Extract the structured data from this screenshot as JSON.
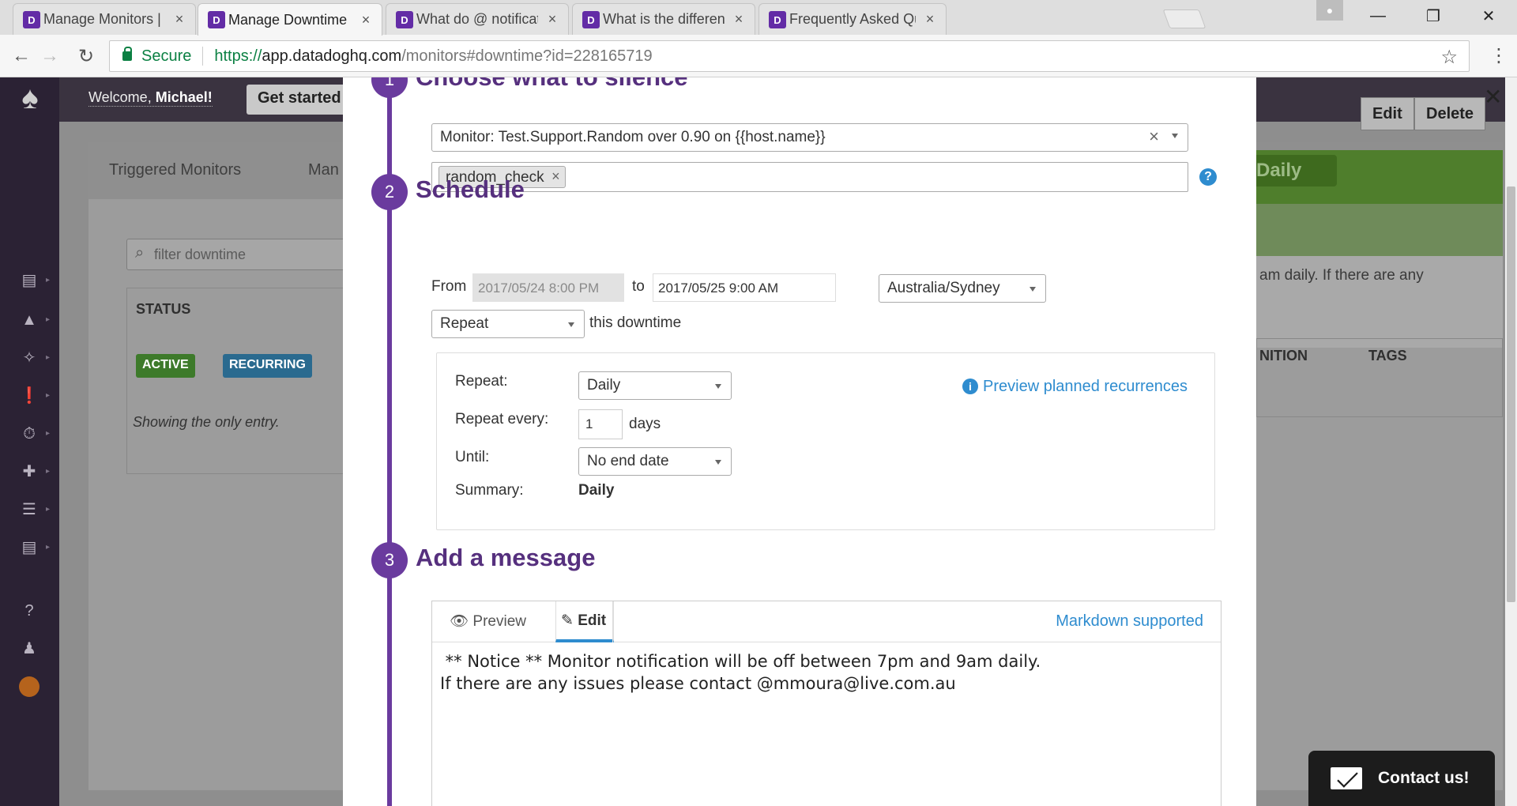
{
  "browser": {
    "tabs": [
      {
        "title": "Manage Monitors | Datad",
        "active": false
      },
      {
        "title": "Manage Downtime | Datad",
        "active": true
      },
      {
        "title": "What do @ notifications",
        "active": false
      },
      {
        "title": "What is the difference be",
        "active": false
      },
      {
        "title": "Frequently Asked Questio",
        "active": false
      }
    ],
    "secure_label": "Secure",
    "url_scheme": "https://",
    "url_host": "app.datadoghq.com",
    "url_path": "/monitors#downtime?id=228165719"
  },
  "app": {
    "welcome_prefix": "Welcome, ",
    "welcome_name": "Michael!",
    "get_started": "Get started",
    "bg_tab_triggered": "Triggered Monitors",
    "bg_tab_manage": "Man",
    "filter_placeholder": "filter downtime",
    "status_header": "STATUS",
    "badge_active": "ACTIVE",
    "badge_recurring": "RECURRING",
    "showing_entry": "Showing the only entry.",
    "edit": "Edit",
    "delete": "Delete",
    "daily_badge": "Daily",
    "bg_message": "am daily. If there are any",
    "bg_col_definition": "NITION",
    "bg_col_tags": "TAGS"
  },
  "modal": {
    "step1": {
      "number": "1",
      "title": "Choose what to silence"
    },
    "monitor_select": "Monitor: Test.Support.Random over 0.90 on {{host.name}}",
    "group_tag": "random_check",
    "step2": {
      "number": "2",
      "title": "Schedule"
    },
    "from_label": "From",
    "from_value": "2017/05/24 8:00 PM",
    "to_label": "to",
    "to_value": "2017/05/25 9:00 AM",
    "timezone": "Australia/Sydney",
    "repeat_mode": "Repeat",
    "repeat_suffix": "this downtime",
    "recurrence": {
      "repeat_label": "Repeat:",
      "repeat_value": "Daily",
      "every_label": "Repeat every:",
      "every_value": "1",
      "every_unit": "days",
      "until_label": "Until:",
      "until_value": "No end date",
      "summary_label": "Summary:",
      "summary_value": "Daily",
      "preview_link": "Preview planned recurrences"
    },
    "step3": {
      "number": "3",
      "title": "Add a message"
    },
    "tab_preview": "Preview",
    "tab_edit": "Edit",
    "markdown_link": "Markdown supported",
    "message": " ** Notice ** Monitor notification will be off between 7pm and 9am daily.\nIf there are any issues please contact @mmoura@live.com.au"
  },
  "contact": {
    "label": "Contact us!"
  },
  "colors": {
    "accent": "#6a3b9e",
    "link": "#2e8ccf",
    "secure": "#0b8043"
  }
}
